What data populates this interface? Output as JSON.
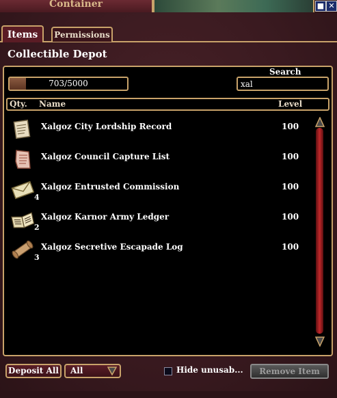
{
  "window": {
    "title": "Container",
    "pin_icon": "pin-icon",
    "close_icon": "close-icon"
  },
  "tabs": [
    {
      "label": "Items",
      "active": true
    },
    {
      "label": "Permissions",
      "active": false
    }
  ],
  "depot_title": "Collectible Depot",
  "capacity": {
    "text": "703/5000",
    "fraction": 0.1406
  },
  "search": {
    "label": "Search",
    "value": "xal"
  },
  "columns": {
    "qty": "Qty.",
    "name": "Name",
    "level": "Level"
  },
  "items": [
    {
      "icon": "scroll-icon",
      "qty": "",
      "name": "Xalgoz City Lordship Record",
      "level": "100"
    },
    {
      "icon": "torn-scroll-icon",
      "qty": "",
      "name": "Xalgoz Council Capture List",
      "level": "100"
    },
    {
      "icon": "envelope-icon",
      "qty": "4",
      "name": "Xalgoz Entrusted Commission",
      "level": "100"
    },
    {
      "icon": "open-book-icon",
      "qty": "2",
      "name": "Xalgoz Karnor Army Ledger",
      "level": "100"
    },
    {
      "icon": "rolled-scroll-icon",
      "qty": "3",
      "name": "Xalgoz Secretive Escapade Log",
      "level": "100"
    }
  ],
  "bottom": {
    "deposit_label": "Deposit All",
    "filter_value": "All",
    "hide_label": "Hide unusab...",
    "hide_checked": false,
    "remove_label": "Remove Item"
  },
  "colors": {
    "gold_border": "#c9a36a",
    "panel_bg": "#3a1a20",
    "scroll_red": "#c0282a"
  }
}
